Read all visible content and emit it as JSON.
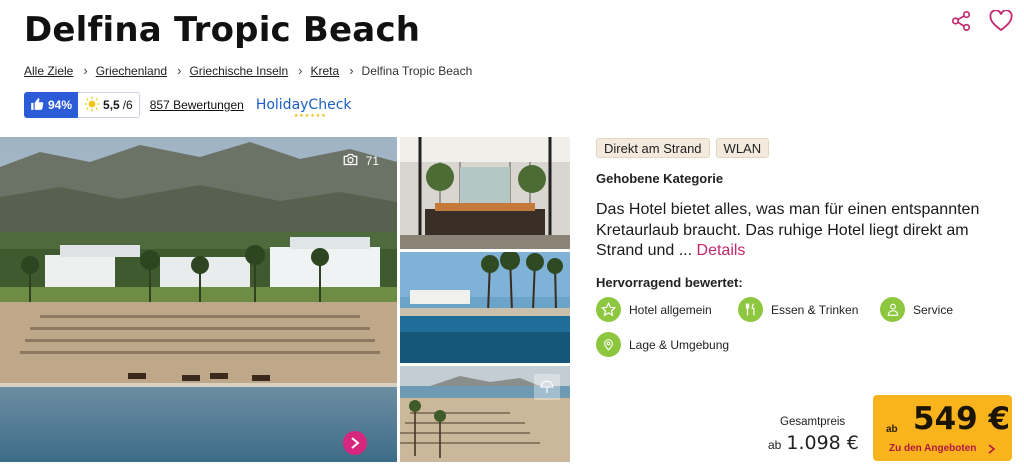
{
  "hotel": {
    "name": "Delfina Tropic Beach"
  },
  "breadcrumb": {
    "items": [
      "Alle Ziele",
      "Griechenland",
      "Griechische Inseln",
      "Kreta"
    ],
    "current": "Delfina Tropic Beach"
  },
  "rating": {
    "recommendation": "94%",
    "sun_score": "5,5",
    "sun_max": "/6",
    "reviews": "857 Bewertungen",
    "provider": "HolidayCheck",
    "provider_stars": "★★★★★★"
  },
  "gallery": {
    "photo_count": "71"
  },
  "tags": [
    "Direkt am Strand",
    "WLAN"
  ],
  "category": "Gehobene Kategorie",
  "description": {
    "text": "Das Hotel bietet alles, was man für einen entspannten Kretaurlaub braucht. Das ruhige Hotel liegt direkt am Strand und ...",
    "more": "Details"
  },
  "rated": {
    "heading": "Hervorragend bewertet:",
    "items": [
      {
        "label": "Hotel allgemein",
        "icon": "star-icon"
      },
      {
        "label": "Essen & Trinken",
        "icon": "cutlery-icon"
      },
      {
        "label": "Service",
        "icon": "service-person-icon"
      },
      {
        "label": "Lage & Umgebung",
        "icon": "location-pin-icon"
      }
    ]
  },
  "price": {
    "label": "Gesamtpreis",
    "prefix": "ab",
    "total": "1.098 €",
    "per_person": "549 €",
    "cta": "Zu den Angeboten"
  },
  "colors": {
    "accent_pink": "#d6267d",
    "brand_blue": "#2b5bd7",
    "cta_yellow": "#f9b31d",
    "rating_green": "#8dc63f"
  }
}
